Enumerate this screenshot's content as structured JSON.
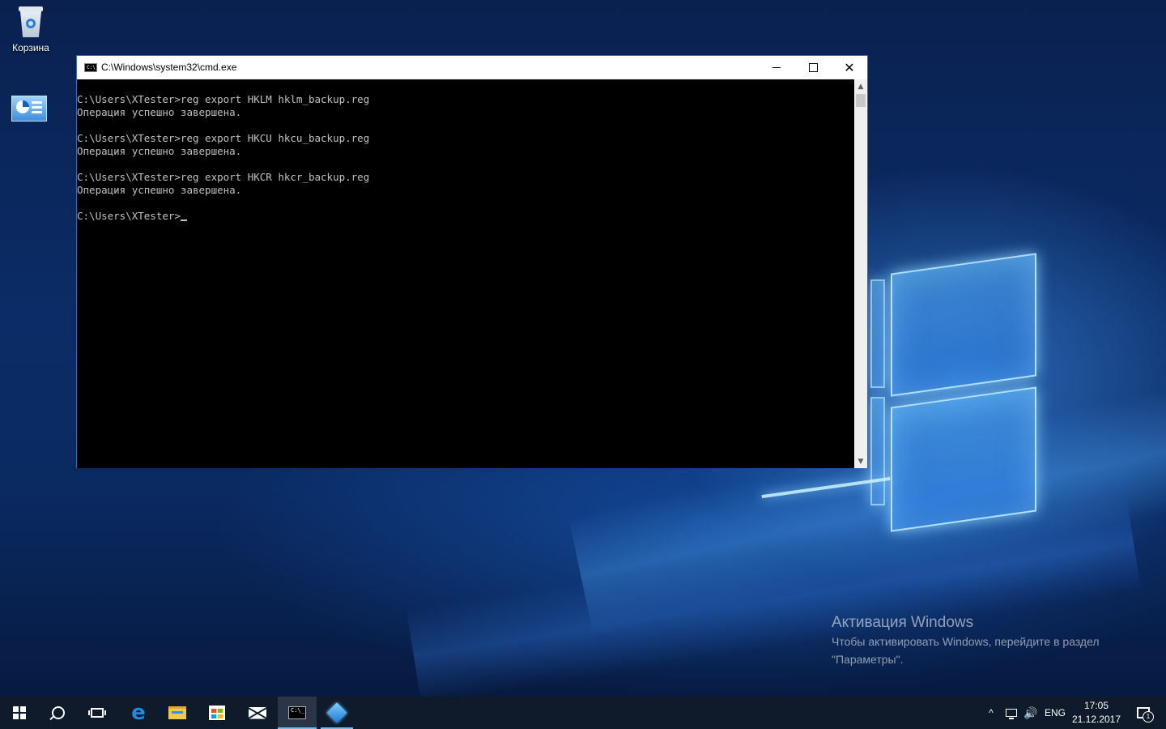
{
  "desktop": {
    "icons": [
      {
        "label": "Корзина",
        "icon": "recycle-bin-icon"
      },
      {
        "label": "",
        "icon": "control-panel-icon"
      }
    ],
    "activation": {
      "title": "Активация Windows",
      "line1": "Чтобы активировать Windows, перейдите в раздел",
      "line2": "\"Параметры\"."
    }
  },
  "window": {
    "title": "C:\\Windows\\system32\\cmd.exe",
    "icon_label": "C:\\",
    "controls": {
      "minimize": "minimize-icon",
      "maximize": "maximize-icon",
      "close": "close-icon"
    },
    "console_lines": [
      "C:\\Users\\XTester>reg export HKLM hklm_backup.reg",
      "Операция успешно завершена.",
      "",
      "C:\\Users\\XTester>reg export HKCU hkcu_backup.reg",
      "Операция успешно завершена.",
      "",
      "C:\\Users\\XTester>reg export HKCR hkcr_backup.reg",
      "Операция успешно завершена.",
      "",
      "C:\\Users\\XTester>"
    ],
    "colors": {
      "background": "#000000",
      "text": "#c0c0c0"
    }
  },
  "taskbar": {
    "items": [
      {
        "name": "start",
        "icon": "windows-logo-icon"
      },
      {
        "name": "search",
        "icon": "search-icon"
      },
      {
        "name": "task-view",
        "icon": "task-view-icon"
      },
      {
        "name": "edge",
        "icon": "edge-icon",
        "glyph": "e"
      },
      {
        "name": "file-explorer",
        "icon": "folder-icon"
      },
      {
        "name": "store",
        "icon": "store-icon"
      },
      {
        "name": "mail",
        "icon": "mail-icon"
      },
      {
        "name": "cmd",
        "icon": "cmd-icon",
        "glyph": "C:\\_"
      },
      {
        "name": "app",
        "icon": "cube-icon"
      }
    ],
    "tray": {
      "chevron": "^",
      "volume": "🔊",
      "language": "ENG",
      "time": "17:05",
      "date": "21.12.2017",
      "notification_count": "1"
    },
    "colors": {
      "background": "#0f1a2a",
      "accent": "#76b9ed"
    }
  }
}
